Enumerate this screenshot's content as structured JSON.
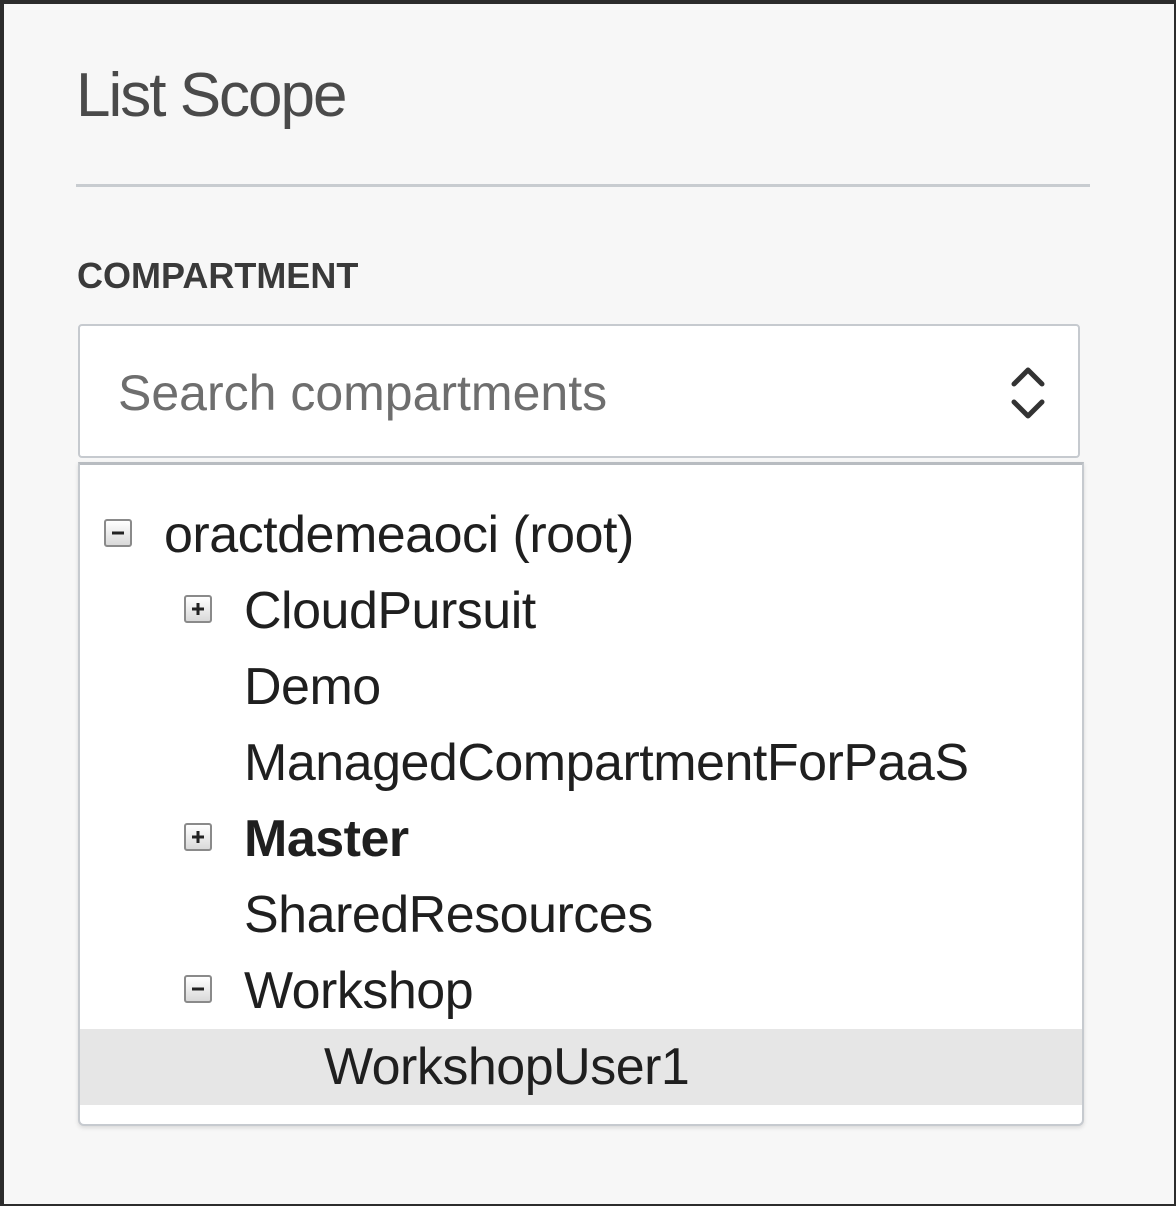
{
  "panel": {
    "title": "List Scope"
  },
  "compartment": {
    "label": "COMPARTMENT",
    "search_placeholder": "Search compartments",
    "search_value": ""
  },
  "tree": {
    "items": [
      {
        "label": "oractdemeaoci (root)",
        "toggle": "collapse",
        "bold": false,
        "selected": false
      },
      {
        "label": "CloudPursuit",
        "toggle": "expand",
        "bold": false,
        "selected": false
      },
      {
        "label": "Demo",
        "toggle": "none",
        "bold": false,
        "selected": false
      },
      {
        "label": "ManagedCompartmentForPaaS",
        "toggle": "none",
        "bold": false,
        "selected": false
      },
      {
        "label": "Master",
        "toggle": "expand",
        "bold": true,
        "selected": false
      },
      {
        "label": "SharedResources",
        "toggle": "none",
        "bold": false,
        "selected": false
      },
      {
        "label": "Workshop",
        "toggle": "collapse",
        "bold": false,
        "selected": false
      },
      {
        "label": "WorkshopUser1",
        "toggle": "none",
        "bold": false,
        "selected": true
      }
    ]
  },
  "icons": {
    "select": "chevron-up-down-icon",
    "expand": "plus-box-icon",
    "collapse": "minus-box-icon"
  },
  "colors": {
    "background": "#f7f7f7",
    "selected_row": "#e6e6e6",
    "border": "#c6cacf"
  }
}
